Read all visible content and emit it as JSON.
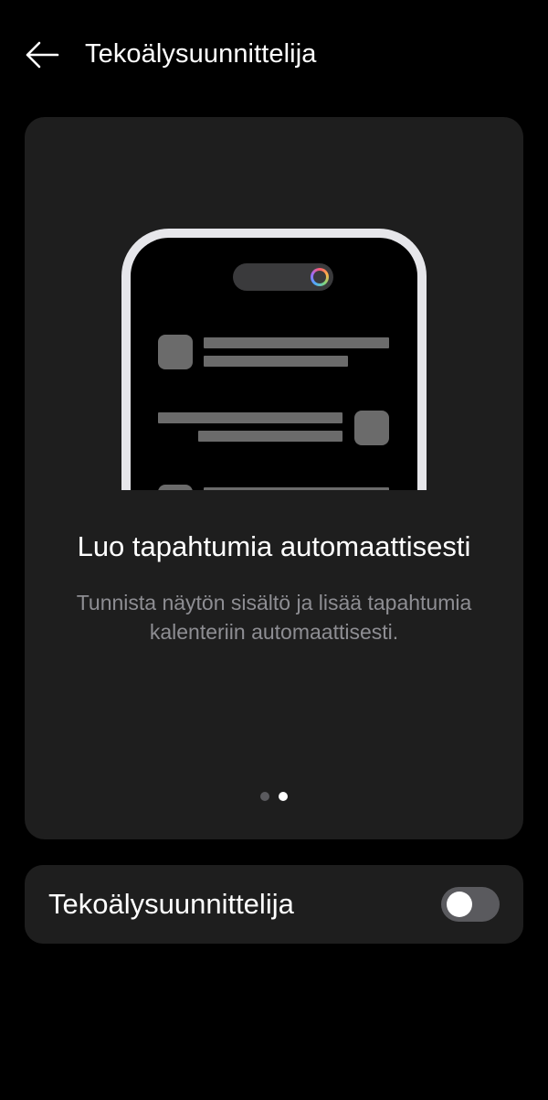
{
  "header": {
    "back_icon": "arrow-left-icon",
    "title": "Tekoälysuunnittelija"
  },
  "promo": {
    "illustration_icon": "phone-ai-assistant-illustration",
    "title": "Luo tapahtumia automaattisesti",
    "description": "Tunnista näytön sisältö ja lisää tapahtumia kalenteriin automaattisesti.",
    "pager": {
      "total": 2,
      "active_index": 1
    }
  },
  "setting": {
    "label": "Tekoälysuunnittelija",
    "enabled": false
  },
  "colors": {
    "background": "#000000",
    "card": "#1e1e1e",
    "text_primary": "#ffffff",
    "text_secondary": "#8e8e93",
    "toggle_off_track": "#5a5a5e",
    "phone_frame": "#e6e6ea",
    "placeholder": "#6b6b6b"
  }
}
